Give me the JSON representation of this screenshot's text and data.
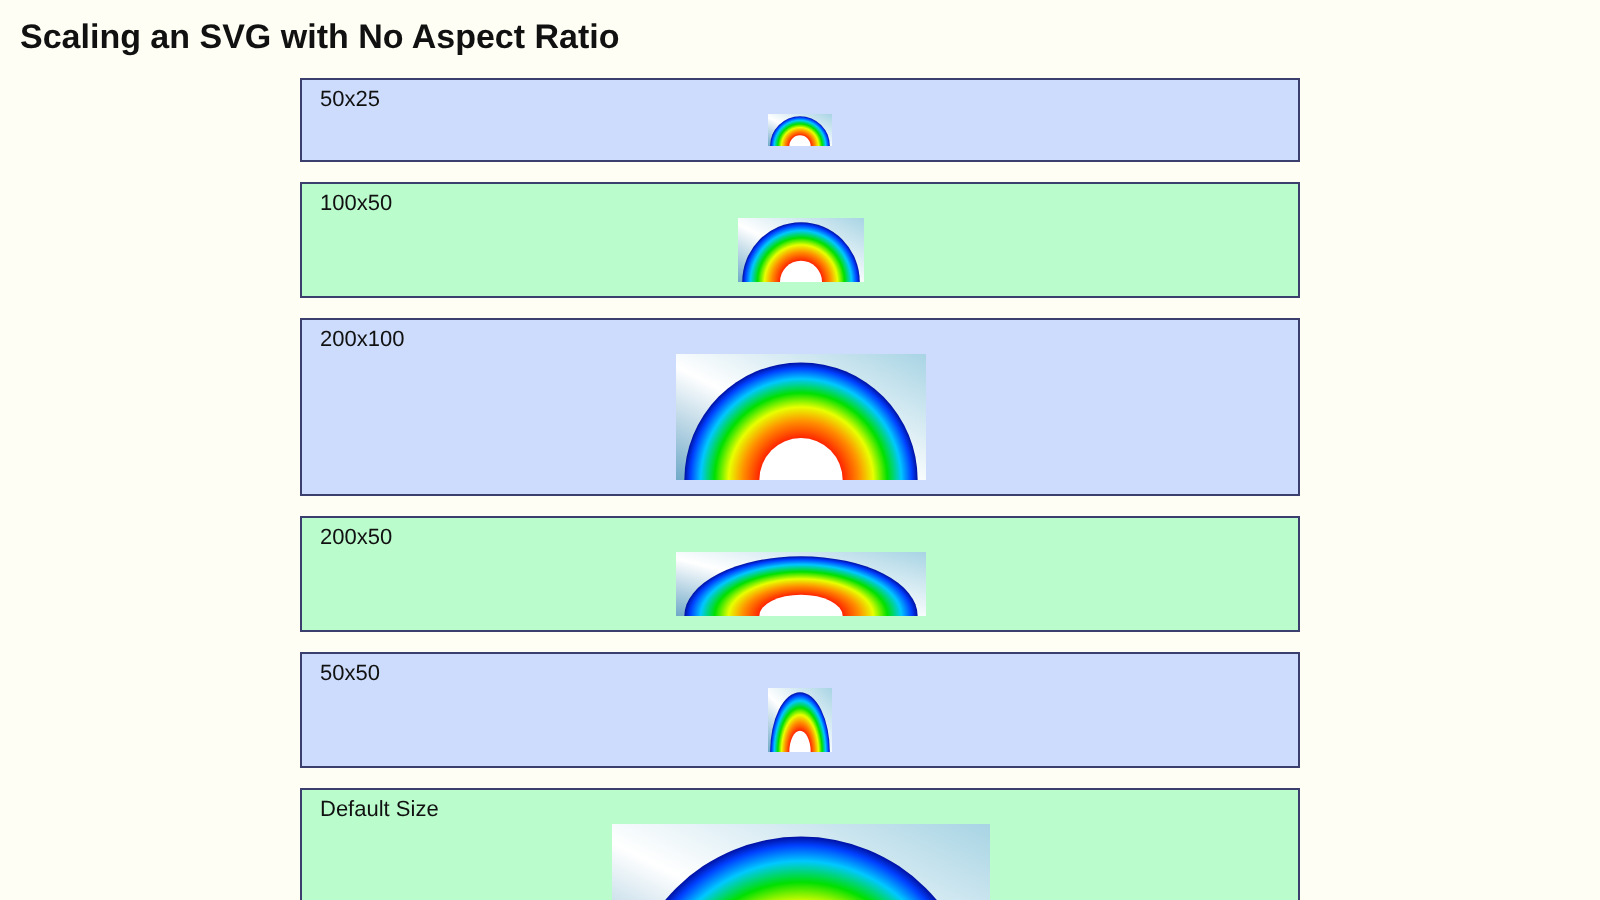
{
  "title": "Scaling an SVG with No Aspect Ratio",
  "panels": [
    {
      "label": "50x25",
      "color": "#cddcfc"
    },
    {
      "label": "100x50",
      "color": "#bbfccd"
    },
    {
      "label": "200x100",
      "color": "#cddcfc"
    },
    {
      "label": "200x50",
      "color": "#bbfccd"
    },
    {
      "label": "50x50",
      "color": "#cddcfc"
    },
    {
      "label": "Default Size",
      "color": "#bbfccd"
    }
  ]
}
